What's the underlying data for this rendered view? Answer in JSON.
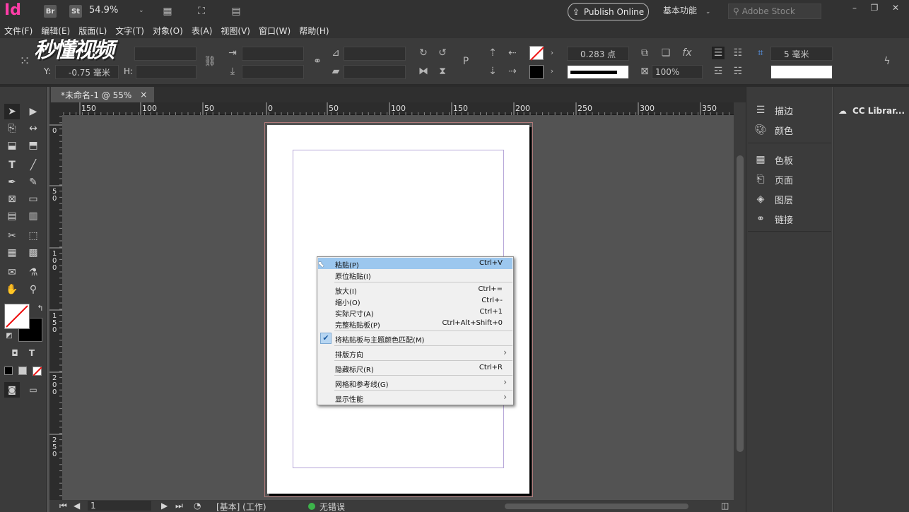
{
  "app": {
    "logo": "Id",
    "bridge_label": "Br",
    "stock_label": "St",
    "zoom": "54.9%",
    "publish_label": "Publish Online",
    "workspace_label": "基本功能",
    "stock_search_placeholder": "Adobe Stock"
  },
  "menubar": {
    "items": [
      "文件(F)",
      "编辑(E)",
      "版面(L)",
      "文字(T)",
      "对象(O)",
      "表(A)",
      "视图(V)",
      "窗口(W)",
      "帮助(H)"
    ]
  },
  "watermark": "秒懂视频",
  "controlbar": {
    "y_label": "Y:",
    "y_value": "-0.75 毫米",
    "h_label": "H:",
    "stroke_weight": "0.283 点",
    "scale_percent": "100%",
    "spacing_value": "5 毫米"
  },
  "document": {
    "tab_title": "*未命名-1 @ 55%",
    "close_glyph": "×"
  },
  "ruler": {
    "h_ticks": [
      "150",
      "100",
      "50",
      "0",
      "50",
      "100",
      "150",
      "200",
      "250",
      "300",
      "350"
    ],
    "v_ticks": [
      "0",
      "5\n0",
      "1\n0\n0",
      "1\n5\n0",
      "2\n0\n0",
      "2\n5\n0"
    ]
  },
  "context_menu": {
    "items": [
      {
        "label": "粘贴(P)",
        "shortcut": "Ctrl+V",
        "highlight": true
      },
      {
        "label": "原位粘贴(I)",
        "shortcut": ""
      },
      {
        "label": "放大(I)",
        "shortcut": "Ctrl+="
      },
      {
        "label": "缩小(O)",
        "shortcut": "Ctrl+-"
      },
      {
        "label": "实际尺寸(A)",
        "shortcut": "Ctrl+1"
      },
      {
        "label": "完整粘贴板(P)",
        "shortcut": "Ctrl+Alt+Shift+0"
      },
      {
        "label": "将粘贴板与主题颜色匹配(M)",
        "shortcut": "",
        "checked": true
      },
      {
        "label": "排版方向",
        "shortcut": "",
        "submenu": true
      },
      {
        "label": "隐藏标尺(R)",
        "shortcut": "Ctrl+R"
      },
      {
        "label": "网格和参考线(G)",
        "shortcut": "",
        "submenu": true
      },
      {
        "label": "显示性能",
        "shortcut": "",
        "submenu": true
      }
    ]
  },
  "panels": {
    "items": [
      "描边",
      "颜色",
      "色板",
      "页面",
      "图层",
      "链接"
    ],
    "cc_libraries": "CC Librar..."
  },
  "statusbar": {
    "page_number": "1",
    "master": "[基本] (工作)",
    "errors": "无错误"
  },
  "colors": {
    "logo": "#ff3da8",
    "highlight": "#9cc7ee",
    "status_ok": "#3cb34a"
  }
}
